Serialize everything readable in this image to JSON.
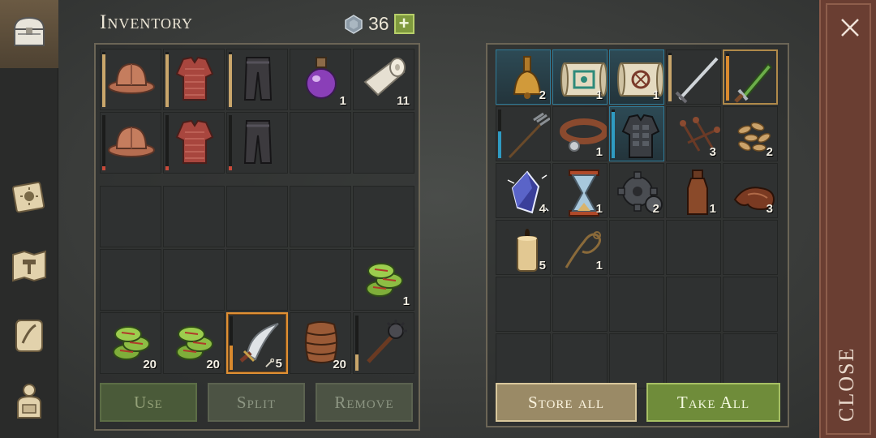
{
  "header": {
    "title": "Inventory",
    "gems": "36",
    "add_label": "+"
  },
  "tabs": [
    {
      "name": "chest-icon"
    },
    {
      "name": "journal-icon"
    },
    {
      "name": "crafting-map-icon"
    },
    {
      "name": "recipe-scroll-icon"
    },
    {
      "name": "character-icon"
    }
  ],
  "equipment": [
    {
      "icon": "helmet",
      "qty": "",
      "bar": "tan",
      "level": 0.95
    },
    {
      "icon": "chainmail",
      "qty": "",
      "bar": "tan",
      "level": 0.95
    },
    {
      "icon": "pants",
      "qty": "",
      "bar": "tan",
      "level": 0.95
    },
    {
      "icon": "potion",
      "qty": "1"
    },
    {
      "icon": "bandage",
      "qty": "11"
    },
    {
      "icon": "helmet",
      "qty": "",
      "bar": "red",
      "level": 0.08
    },
    {
      "icon": "chainmail",
      "qty": "",
      "bar": "red",
      "level": 0.08
    },
    {
      "icon": "pants",
      "qty": "",
      "bar": "red",
      "level": 0.08
    },
    {
      "icon": "",
      "qty": ""
    },
    {
      "icon": "",
      "qty": ""
    }
  ],
  "backpack": [
    {
      "icon": "",
      "qty": ""
    },
    {
      "icon": "",
      "qty": ""
    },
    {
      "icon": "",
      "qty": ""
    },
    {
      "icon": "",
      "qty": ""
    },
    {
      "icon": "",
      "qty": ""
    },
    {
      "icon": "",
      "qty": ""
    },
    {
      "icon": "",
      "qty": ""
    },
    {
      "icon": "",
      "qty": ""
    },
    {
      "icon": "",
      "qty": ""
    },
    {
      "icon": "coins",
      "qty": "1"
    },
    {
      "icon": "coins",
      "qty": "20"
    },
    {
      "icon": "coins",
      "qty": "20"
    },
    {
      "icon": "scimitar",
      "qty": "5",
      "dur": true,
      "bar": "orange",
      "level": 0.45,
      "selected": true
    },
    {
      "icon": "barrel",
      "qty": "20"
    },
    {
      "icon": "mace",
      "qty": "",
      "bar": "tan",
      "level": 0.3
    }
  ],
  "storage": [
    {
      "icon": "bell",
      "qty": "2",
      "blue": true
    },
    {
      "icon": "map-green",
      "qty": "1",
      "blue": true
    },
    {
      "icon": "map-red",
      "qty": "1",
      "blue": true
    },
    {
      "icon": "sword",
      "qty": "",
      "bar": "tan",
      "level": 0.95
    },
    {
      "icon": "dagger",
      "qty": "",
      "bar": "orange",
      "level": 0.95,
      "gold": true
    },
    {
      "icon": "pitchfork",
      "qty": "",
      "bar": "blue",
      "level": 0.55
    },
    {
      "icon": "collar",
      "qty": "1"
    },
    {
      "icon": "armor",
      "qty": "",
      "bar": "blue",
      "level": 0.95,
      "blue": true
    },
    {
      "icon": "nails",
      "qty": "3"
    },
    {
      "icon": "seeds",
      "qty": "2"
    },
    {
      "icon": "crystal",
      "qty": "4"
    },
    {
      "icon": "hourglass",
      "qty": "1"
    },
    {
      "icon": "gear",
      "qty": "2"
    },
    {
      "icon": "bottle",
      "qty": "1"
    },
    {
      "icon": "leather",
      "qty": "3"
    },
    {
      "icon": "candle",
      "qty": "5"
    },
    {
      "icon": "rope",
      "qty": "1"
    },
    {
      "icon": "",
      "qty": ""
    },
    {
      "icon": "",
      "qty": ""
    },
    {
      "icon": "",
      "qty": ""
    },
    {
      "icon": "",
      "qty": ""
    },
    {
      "icon": "",
      "qty": ""
    },
    {
      "icon": "",
      "qty": ""
    },
    {
      "icon": "",
      "qty": ""
    },
    {
      "icon": "",
      "qty": ""
    },
    {
      "icon": "",
      "qty": ""
    },
    {
      "icon": "",
      "qty": ""
    },
    {
      "icon": "",
      "qty": ""
    },
    {
      "icon": "",
      "qty": ""
    },
    {
      "icon": "",
      "qty": ""
    }
  ],
  "buttons": {
    "use": "Use",
    "split": "Split",
    "remove": "Remove",
    "store_all": "Store all",
    "take_all": "Take All"
  },
  "close": {
    "label": "CLOSE"
  }
}
